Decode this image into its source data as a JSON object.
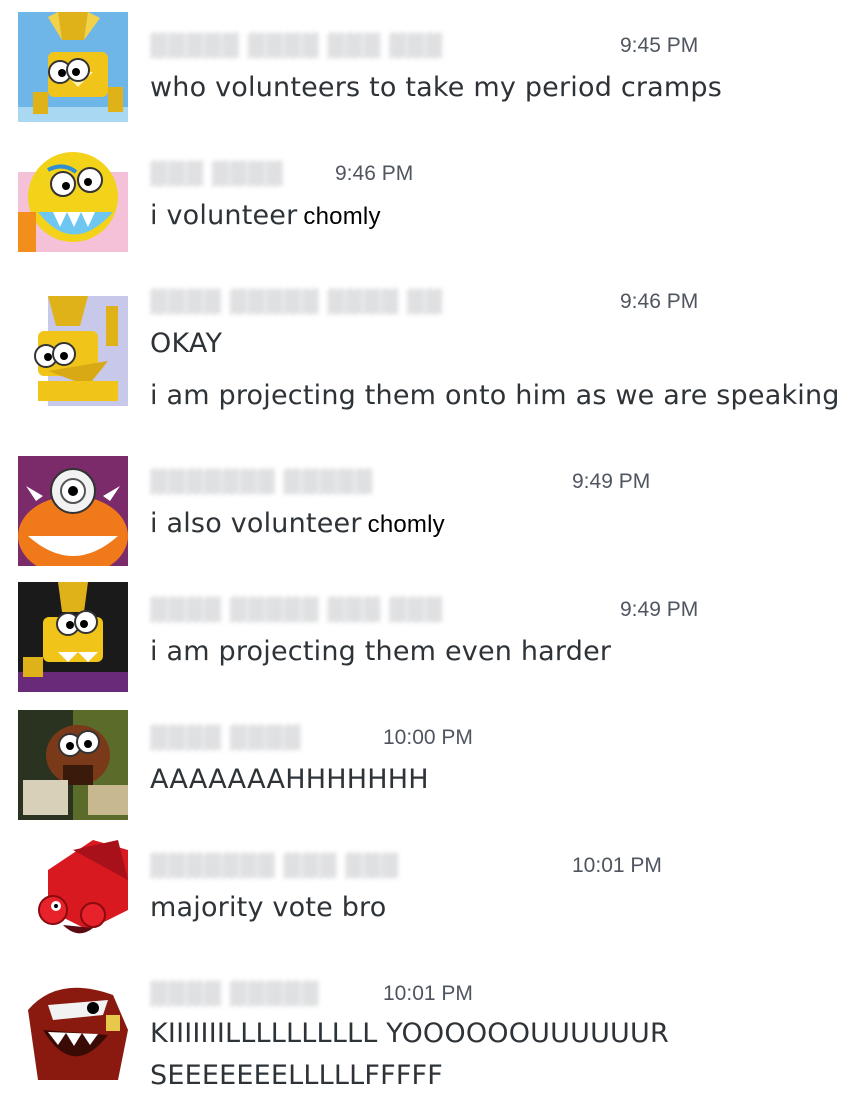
{
  "messages": [
    {
      "time": "9:45 PM",
      "lines": [
        "who volunteers to take my period cramps"
      ],
      "tag": ""
    },
    {
      "time": "9:46 PM",
      "lines": [
        "i volunteer"
      ],
      "tag": "chomly"
    },
    {
      "time": "9:46 PM",
      "lines": [
        "OKAY",
        "i am projecting them onto him as we are speaking"
      ],
      "tag": ""
    },
    {
      "time": "9:49 PM",
      "lines": [
        "i also volunteer"
      ],
      "tag": "chomly"
    },
    {
      "time": "9:49 PM",
      "lines": [
        "i am projecting them even harder"
      ],
      "tag": ""
    },
    {
      "time": "10:00 PM",
      "lines": [
        "AAAAAAAHHHHHHH"
      ],
      "tag": ""
    },
    {
      "time": "10:01 PM",
      "lines": [
        "majority vote bro"
      ],
      "tag": ""
    },
    {
      "time": "10:01 PM",
      "lines": [
        "KIIIIIIILLLLLLLLLL YOOOOOOUUUUUUR",
        "SEEEEEEELLLLLFFFFF"
      ],
      "tag": ""
    }
  ],
  "colors": {
    "text": "#2e3338",
    "timestamp": "#4f5660",
    "redacted_name": "#d9dadc"
  }
}
